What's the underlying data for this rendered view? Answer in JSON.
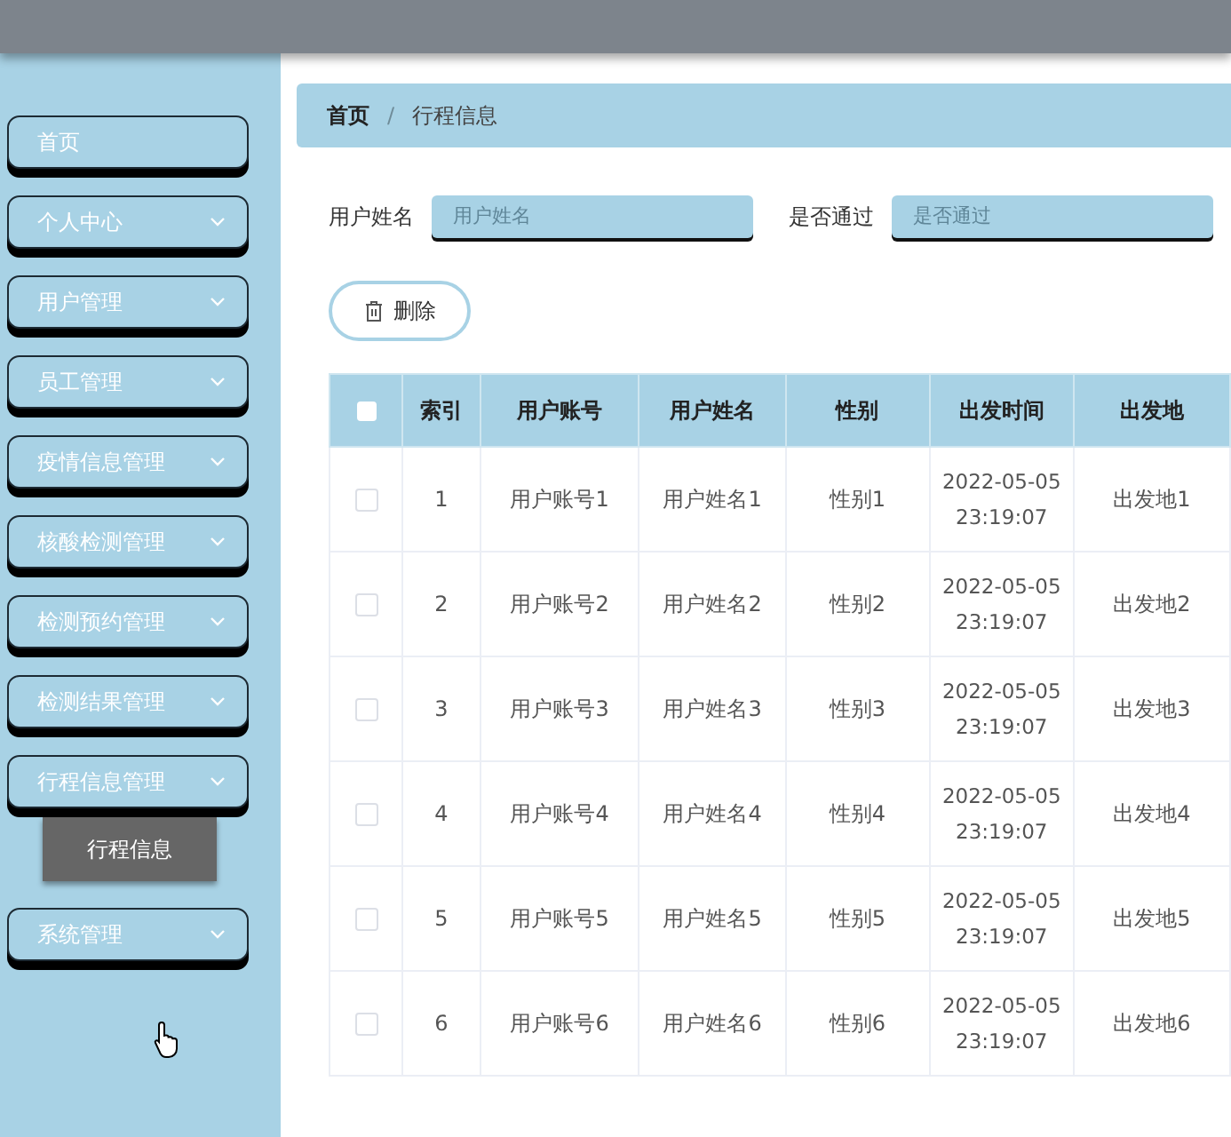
{
  "sidebar": {
    "items": [
      {
        "label": "首页",
        "expandable": false
      },
      {
        "label": "个人中心",
        "expandable": true
      },
      {
        "label": "用户管理",
        "expandable": true
      },
      {
        "label": "员工管理",
        "expandable": true
      },
      {
        "label": "疫情信息管理",
        "expandable": true
      },
      {
        "label": "核酸检测管理",
        "expandable": true
      },
      {
        "label": "检测预约管理",
        "expandable": true
      },
      {
        "label": "检测结果管理",
        "expandable": true
      },
      {
        "label": "行程信息管理",
        "expandable": true,
        "expanded": true,
        "children": [
          {
            "label": "行程信息",
            "selected": true
          }
        ]
      },
      {
        "label": "系统管理",
        "expandable": true
      }
    ]
  },
  "breadcrumb": [
    "首页",
    "行程信息"
  ],
  "breadcrumb_separator": "/",
  "search": [
    {
      "label": "用户姓名",
      "placeholder": "用户姓名"
    },
    {
      "label": "是否通过",
      "placeholder": "是否通过"
    }
  ],
  "delete_button": "删除",
  "table": {
    "all_checked": false,
    "columns": [
      "索引",
      "用户账号",
      "用户姓名",
      "性别",
      "出发时间",
      "出发地"
    ],
    "rows": [
      {
        "checked": false,
        "cells": [
          "1",
          "用户账号1",
          "用户姓名1",
          "性别1",
          "2022-05-05 23:19:07",
          "出发地1"
        ]
      },
      {
        "checked": false,
        "cells": [
          "2",
          "用户账号2",
          "用户姓名2",
          "性别2",
          "2022-05-05 23:19:07",
          "出发地2"
        ]
      },
      {
        "checked": false,
        "cells": [
          "3",
          "用户账号3",
          "用户姓名3",
          "性别3",
          "2022-05-05 23:19:07",
          "出发地3"
        ]
      },
      {
        "checked": false,
        "cells": [
          "4",
          "用户账号4",
          "用户姓名4",
          "性别4",
          "2022-05-05 23:19:07",
          "出发地4"
        ]
      },
      {
        "checked": false,
        "cells": [
          "5",
          "用户账号5",
          "用户姓名5",
          "性别5",
          "2022-05-05 23:19:07",
          "出发地5"
        ]
      },
      {
        "checked": false,
        "cells": [
          "6",
          "用户账号6",
          "用户姓名6",
          "性别6",
          "2022-05-05 23:19:07",
          "出发地6"
        ]
      }
    ]
  }
}
